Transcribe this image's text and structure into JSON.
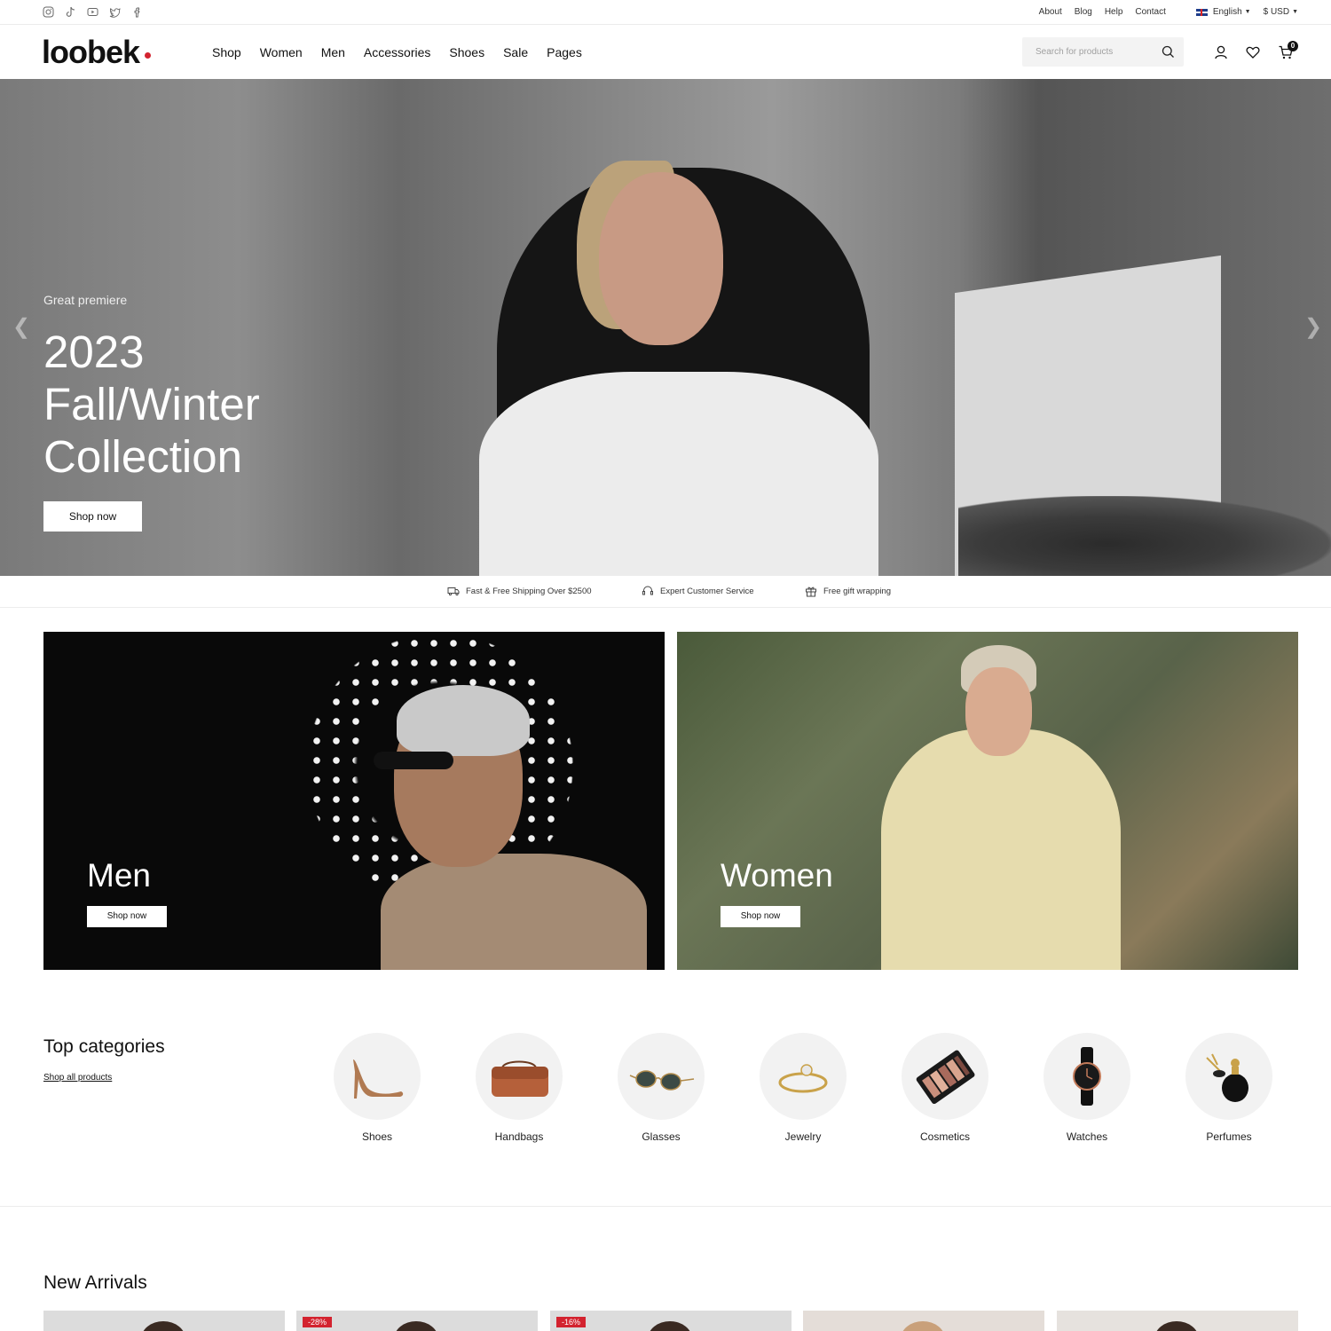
{
  "topbar": {
    "social": [
      "instagram-icon",
      "tiktok-icon",
      "youtube-icon",
      "twitter-icon",
      "facebook-icon"
    ],
    "links": [
      "About",
      "Blog",
      "Help",
      "Contact"
    ],
    "language": "English",
    "currency": "$ USD"
  },
  "header": {
    "logo": "loobek",
    "nav": [
      "Shop",
      "Women",
      "Men",
      "Accessories",
      "Shoes",
      "Sale",
      "Pages"
    ],
    "search_placeholder": "Search for products",
    "cart_count": "0"
  },
  "hero": {
    "eyebrow": "Great premiere",
    "title_line1": "2023",
    "title_line2": "Fall/Winter",
    "title_line3": "Collection",
    "button": "Shop now",
    "prev_arrow": "❮",
    "next_arrow": "❯"
  },
  "features": [
    {
      "icon": "truck-icon",
      "text": "Fast & Free Shipping Over $2500"
    },
    {
      "icon": "headset-icon",
      "text": "Expert Customer Service"
    },
    {
      "icon": "gift-icon",
      "text": "Free gift wrapping"
    }
  ],
  "promos": [
    {
      "title": "Men",
      "button": "Shop now"
    },
    {
      "title": "Women",
      "button": "Shop now"
    }
  ],
  "categories": {
    "heading": "Top categories",
    "link": "Shop all products",
    "items": [
      {
        "label": "Shoes",
        "icon": "high-heel-icon"
      },
      {
        "label": "Handbags",
        "icon": "handbag-icon"
      },
      {
        "label": "Glasses",
        "icon": "sunglasses-icon"
      },
      {
        "label": "Jewelry",
        "icon": "ring-icon"
      },
      {
        "label": "Cosmetics",
        "icon": "eyeshadow-palette-icon"
      },
      {
        "label": "Watches",
        "icon": "watch-icon"
      },
      {
        "label": "Perfumes",
        "icon": "perfume-icon"
      }
    ]
  },
  "new_arrivals": {
    "heading": "New Arrivals",
    "products": [
      {
        "badge": ""
      },
      {
        "badge": "-28%"
      },
      {
        "badge": "-16%"
      },
      {
        "badge": ""
      },
      {
        "badge": ""
      }
    ]
  },
  "colors": {
    "accent": "#d3232f",
    "text": "#111111",
    "light_bg": "#f2f2f2"
  }
}
